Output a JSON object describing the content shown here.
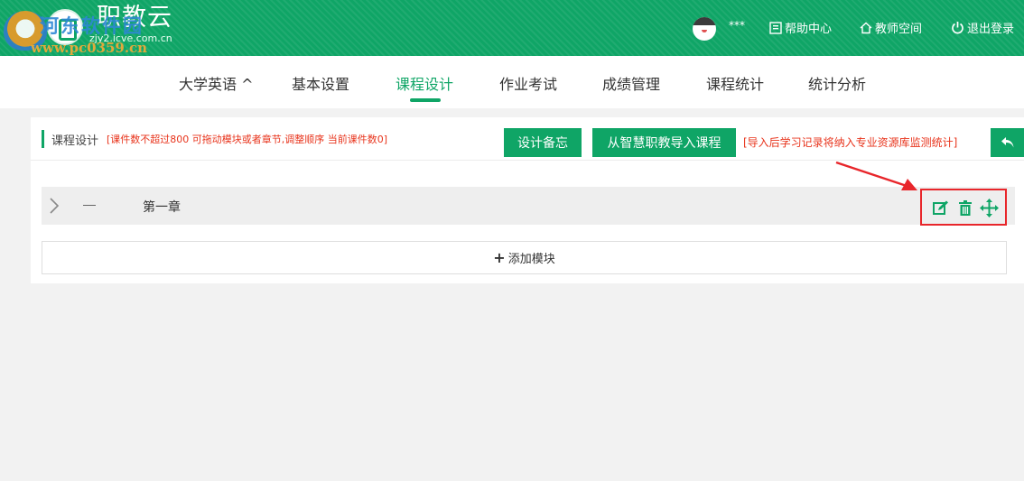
{
  "header": {
    "logo_title": "职教云",
    "logo_sub": "zjy2.icve.com.cn",
    "watermark_text": "河东软件园",
    "watermark_url": "www.pc0359.cn",
    "user_name": "***",
    "links": {
      "help": "帮助中心",
      "teacher_space": "教师空间",
      "logout": "退出登录"
    }
  },
  "nav": {
    "items": [
      "大学英语 ^",
      "基本设置",
      "课程设计",
      "作业考试",
      "成绩管理",
      "课程统计",
      "统计分析"
    ],
    "active_index": 2
  },
  "design": {
    "title": "课程设计",
    "notice": "[课件数不超过800 可拖动模块或者章节,调整顺序 当前课件数0]",
    "memo_button": "设计备忘",
    "import_button": "从智慧职教导入课程",
    "import_note": "[导入后学习记录将纳入专业资源库监测统计]"
  },
  "chapter": {
    "title": "第一章"
  },
  "add_module": {
    "plus": "+",
    "label": "添加模块"
  },
  "colors": {
    "brand_green": "#0fa566",
    "notice_red": "#e8341c",
    "highlight_red": "#e8262b",
    "page_bg": "#f2f2f2"
  },
  "icons": [
    "chevron-right-icon",
    "edit-icon",
    "trash-icon",
    "move-icon",
    "back-arrow-icon",
    "help-icon",
    "home-icon",
    "power-icon"
  ]
}
